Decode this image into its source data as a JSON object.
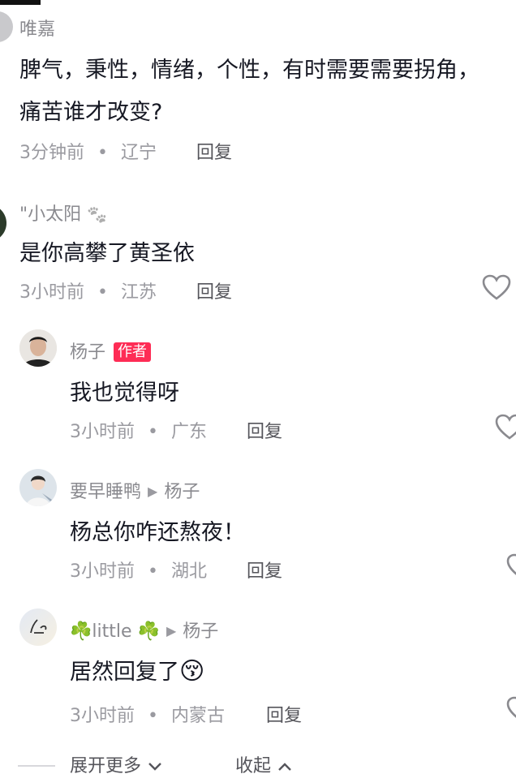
{
  "comments": [
    {
      "username": "唯嘉",
      "text_line1": "脾气，秉性，情绪，个性，有时需要需要拐角，",
      "text_line2": "痛苦谁才改变?",
      "time": "3分钟前",
      "location": "辽宁",
      "reply_label": "回复",
      "dot": "•"
    },
    {
      "username": "\"小太阳",
      "paw": "🐾",
      "text": "是你高攀了黄圣依",
      "time": "3小时前",
      "location": "江苏",
      "reply_label": "回复",
      "dot": "•"
    }
  ],
  "replies": [
    {
      "username": "杨子",
      "badge": "作者",
      "text": "我也觉得呀",
      "time": "3小时前",
      "location": "广东",
      "reply_label": "回复",
      "dot": "•"
    },
    {
      "username": "要早睡鸭",
      "reply_to": "杨子",
      "text": "杨总你咋还熬夜！",
      "time": "3小时前",
      "location": "湖北",
      "reply_label": "回复",
      "dot": "•"
    },
    {
      "username": "little",
      "clover_left": "☘️",
      "clover_right": "☘️",
      "reply_to": "杨子",
      "text": "居然回复了",
      "emoji": "😚",
      "time": "3小时前",
      "location": "内蒙古",
      "reply_label": "回复",
      "dot": "•"
    }
  ],
  "footer": {
    "expand_label": "展开更多",
    "collapse_label": "收起"
  }
}
